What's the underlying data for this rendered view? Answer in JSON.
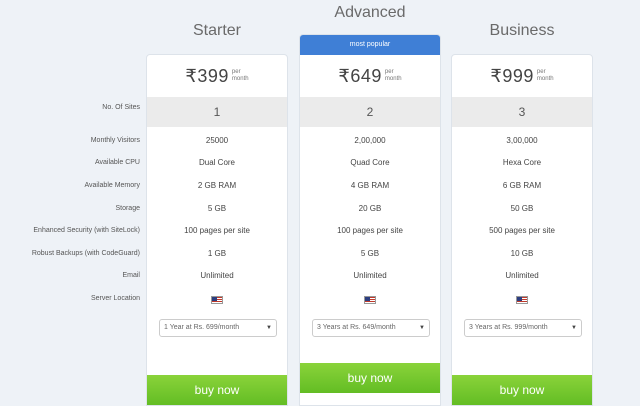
{
  "labels": {
    "sites": "No. Of Sites",
    "visitors": "Monthly Visitors",
    "cpu": "Available CPU",
    "memory": "Available Memory",
    "storage": "Storage",
    "security": "Enhanced Security (with SiteLock)",
    "backups": "Robust Backups (with CodeGuard)",
    "email": "Email",
    "location": "Server Location"
  },
  "plans": [
    {
      "title": "Starter",
      "price": "₹399",
      "per_1": "per",
      "per_2": "month",
      "sites": "1",
      "visitors": "25000",
      "cpu": "Dual Core",
      "memory": "2 GB RAM",
      "storage": "5 GB",
      "security": "100 pages per site",
      "backups": "1 GB",
      "email": "Unlimited",
      "location_flag": "us-flag-icon",
      "term": "1 Year at Rs. 699/month",
      "buy": "buy now"
    },
    {
      "title": "Advanced",
      "badge": "most popular",
      "price": "₹649",
      "per_1": "per",
      "per_2": "month",
      "sites": "2",
      "visitors": "2,00,000",
      "cpu": "Quad Core",
      "memory": "4 GB RAM",
      "storage": "20 GB",
      "security": "100 pages per site",
      "backups": "5 GB",
      "email": "Unlimited",
      "location_flag": "us-flag-icon",
      "term": "3 Years at Rs. 649/month",
      "buy": "buy now"
    },
    {
      "title": "Business",
      "price": "₹999",
      "per_1": "per",
      "per_2": "month",
      "sites": "3",
      "visitors": "3,00,000",
      "cpu": "Hexa Core",
      "memory": "6 GB RAM",
      "storage": "50 GB",
      "security": "500 pages per site",
      "backups": "10 GB",
      "email": "Unlimited",
      "location_flag": "us-flag-icon",
      "term": "3 Years at Rs. 999/month",
      "buy": "buy now"
    }
  ],
  "colors": {
    "popular_badge": "#3f7fd6",
    "buy_button": "#6cc22b",
    "background": "#eef2f7"
  }
}
